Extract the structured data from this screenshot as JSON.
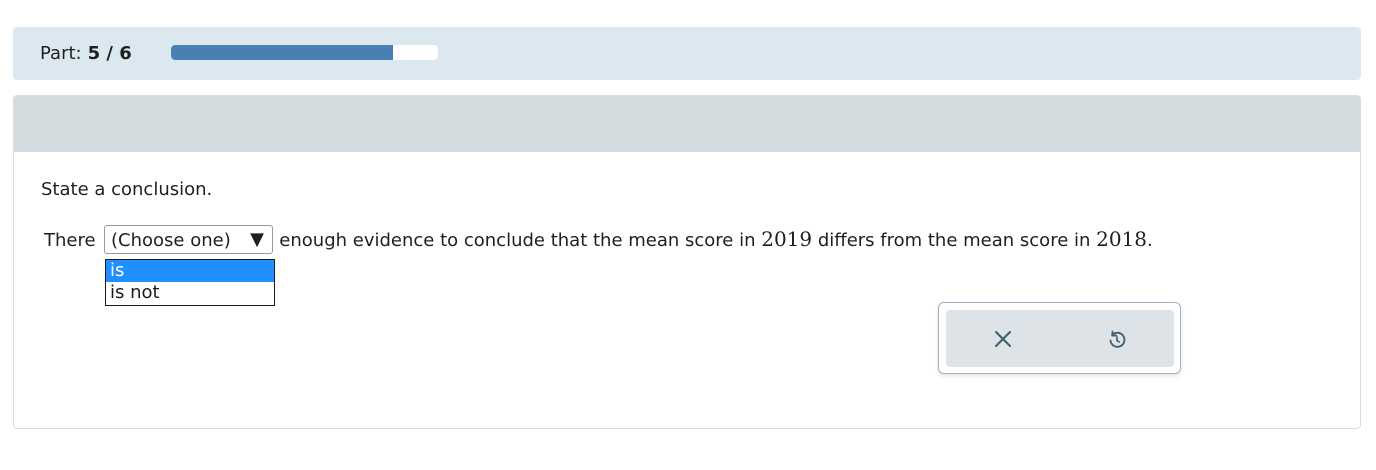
{
  "part": {
    "label": "Part:",
    "value": "5 / 6",
    "progress_fraction": 0.83
  },
  "question": {
    "prompt": "State a conclusion.",
    "sentence_start": "There",
    "sentence_middle": " enough evidence to conclude that the mean score in ",
    "year_a": "2019",
    "sentence_between": " differs from the mean score in ",
    "year_b": "2018",
    "sentence_end": "."
  },
  "dropdown": {
    "selected": "(Choose one)",
    "arrow": "▼",
    "options": [
      "is",
      "is not"
    ],
    "highlighted_index": 0
  },
  "tools": {
    "clear_icon": "close-icon",
    "undo_icon": "undo-icon"
  },
  "colors": {
    "progress_fill": "#4a7fb5",
    "header_band": "#d4dcdf",
    "part_band": "#dce8f0",
    "option_highlight": "#1e90ff",
    "icon": "#3f5f70"
  }
}
